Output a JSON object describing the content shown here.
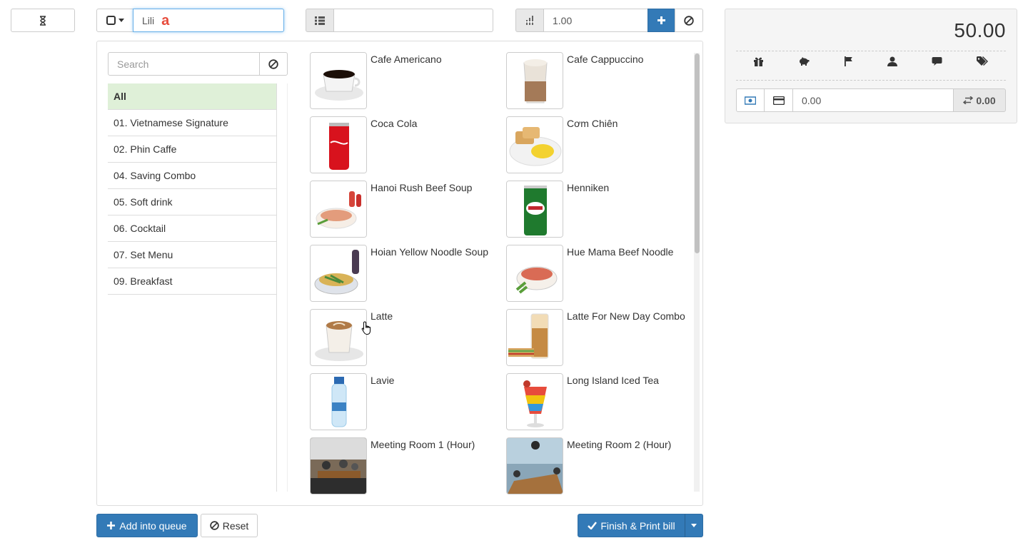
{
  "toolbar": {
    "hourglass_icon": "hourglass-icon",
    "table_select_icon": "square-icon",
    "customer_value": "Lili",
    "list_icon": "list-icon",
    "note_value": "",
    "quantity_icon": "sort-numeric-icon",
    "quantity_value": "1.00",
    "add_icon": "plus-icon",
    "clear_icon": "ban-icon"
  },
  "menu": {
    "search_placeholder": "Search",
    "categories": [
      {
        "label": "All",
        "active": true
      },
      {
        "label": "01. Vietnamese Signature"
      },
      {
        "label": "02. Phin Caffe"
      },
      {
        "label": "04. Saving Combo"
      },
      {
        "label": "05. Soft drink"
      },
      {
        "label": "06. Cocktail"
      },
      {
        "label": "07. Set Menu"
      },
      {
        "label": "09. Breakfast"
      }
    ],
    "products": [
      {
        "name": "Cafe Americano"
      },
      {
        "name": "Cafe Cappuccino"
      },
      {
        "name": "Coca Cola"
      },
      {
        "name": "Cơm Chiên"
      },
      {
        "name": "Hanoi Rush Beef Soup"
      },
      {
        "name": "Henniken"
      },
      {
        "name": "Hoian Yellow Noodle Soup"
      },
      {
        "name": "Hue Mama Beef Noodle"
      },
      {
        "name": "Latte"
      },
      {
        "name": "Latte For New Day Combo"
      },
      {
        "name": "Lavie"
      },
      {
        "name": "Long Island Iced Tea"
      },
      {
        "name": "Meeting Room 1 (Hour)"
      },
      {
        "name": "Meeting Room 2 (Hour)"
      }
    ]
  },
  "summary": {
    "total": "50.00",
    "action_icons": [
      "gift-icon",
      "piggy-bank-icon",
      "flag-icon",
      "user-icon",
      "comment-icon",
      "tags-icon"
    ],
    "paid_value": "0.00",
    "change_value": "0.00"
  },
  "footer": {
    "add_queue_label": "Add into queue",
    "reset_label": "Reset",
    "finish_label": "Finish & Print bill"
  },
  "colors": {
    "primary": "#337ab7",
    "active_category": "#dff0d8",
    "focus_border": "#66afe9"
  }
}
